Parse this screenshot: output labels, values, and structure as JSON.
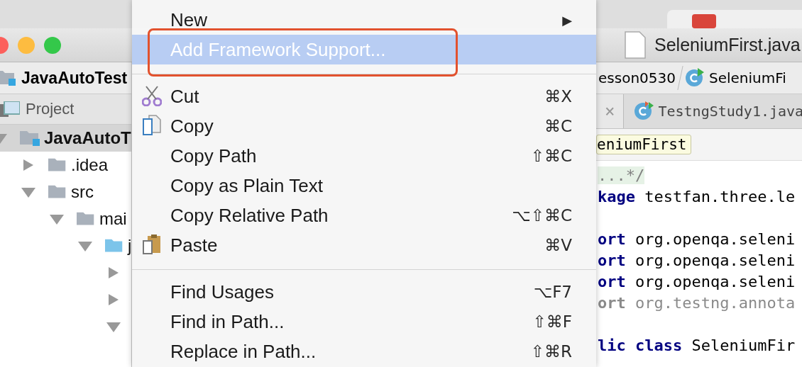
{
  "window": {
    "title": "SeleniumFirst.java"
  },
  "project_bar": {
    "label": "JavaAutoTest"
  },
  "project_panel": {
    "title": "Project",
    "tree": [
      {
        "label": "JavaAutoT",
        "expanded": true,
        "selected": true,
        "children": [
          {
            "label": ".idea",
            "expanded": false,
            "selected": false
          },
          {
            "label": "src",
            "expanded": true,
            "selected": false,
            "children": [
              {
                "label": "mai",
                "expanded": true,
                "selected": false,
                "children": [
                  {
                    "label": "j",
                    "expanded": true,
                    "selected": false,
                    "children": [
                      {
                        "expanded": false,
                        "selected": false
                      },
                      {
                        "expanded": false,
                        "selected": false
                      },
                      {
                        "expanded": true,
                        "selected": false
                      }
                    ]
                  }
                ]
              }
            ]
          }
        ]
      }
    ]
  },
  "breadcrumbs": [
    {
      "label": "esson0530"
    },
    {
      "label": "SeleniumFi"
    }
  ],
  "editor_tabs": [
    {
      "close": "×",
      "selected": true
    },
    {
      "label": "TestngStudy1.java",
      "selected": false
    }
  ],
  "editor": {
    "class_tag": "eniumFirst",
    "lines": [
      {
        "kind": "code",
        "tokens": [
          {
            "kind": "comment",
            "text": "...*/"
          }
        ]
      },
      {
        "kind": "code",
        "tokens": [
          {
            "kind": "keyword",
            "text": "kage"
          },
          {
            "kind": "plain",
            "text": " testfan.three.le"
          }
        ]
      },
      {
        "kind": "blank"
      },
      {
        "kind": "code",
        "tokens": [
          {
            "kind": "keyword",
            "text": "ort"
          },
          {
            "kind": "plain",
            "text": " org.openqa.seleni"
          }
        ]
      },
      {
        "kind": "code",
        "tokens": [
          {
            "kind": "keyword",
            "text": "ort"
          },
          {
            "kind": "plain",
            "text": " org.openqa.seleni"
          }
        ]
      },
      {
        "kind": "code",
        "tokens": [
          {
            "kind": "keyword",
            "text": "ort"
          },
          {
            "kind": "plain",
            "text": " org.openqa.seleni"
          }
        ]
      },
      {
        "kind": "code",
        "tokens": [
          {
            "kind": "unused",
            "text": "ort"
          },
          {
            "kind": "unused",
            "text": " org.testng.annota"
          }
        ]
      },
      {
        "kind": "blank"
      },
      {
        "kind": "code",
        "tokens": [
          {
            "kind": "keyword",
            "text": "lic class"
          },
          {
            "kind": "plain",
            "text": " SeleniumFir"
          }
        ]
      }
    ]
  },
  "context_menu": {
    "items": [
      {
        "kind": "item",
        "label": "New",
        "shortcut": "▶",
        "selected": false
      },
      {
        "kind": "item",
        "label": "Add Framework Support...",
        "selected": true,
        "highlighted": true
      },
      {
        "kind": "separator"
      },
      {
        "kind": "cut",
        "label": "Cut",
        "shortcut": "⌘X",
        "selected": false
      },
      {
        "kind": "copy",
        "label": "Copy",
        "shortcut": "⌘C",
        "selected": false
      },
      {
        "kind": "item",
        "label": "Copy Path",
        "shortcut": "⇧⌘C",
        "selected": false
      },
      {
        "kind": "item",
        "label": "Copy as Plain Text",
        "selected": false
      },
      {
        "kind": "item",
        "label": "Copy Relative Path",
        "shortcut": "⌥⇧⌘C",
        "selected": false
      },
      {
        "kind": "paste",
        "label": "Paste",
        "shortcut": "⌘V",
        "selected": false
      },
      {
        "kind": "separator"
      },
      {
        "kind": "item",
        "label": "Find Usages",
        "shortcut": "⌥F7",
        "selected": false
      },
      {
        "kind": "item",
        "label": "Find in Path...",
        "shortcut": "⇧⌘F",
        "selected": false
      },
      {
        "kind": "item",
        "label": "Replace in Path...",
        "shortcut": "⇧⌘R",
        "selected": false
      }
    ]
  }
}
